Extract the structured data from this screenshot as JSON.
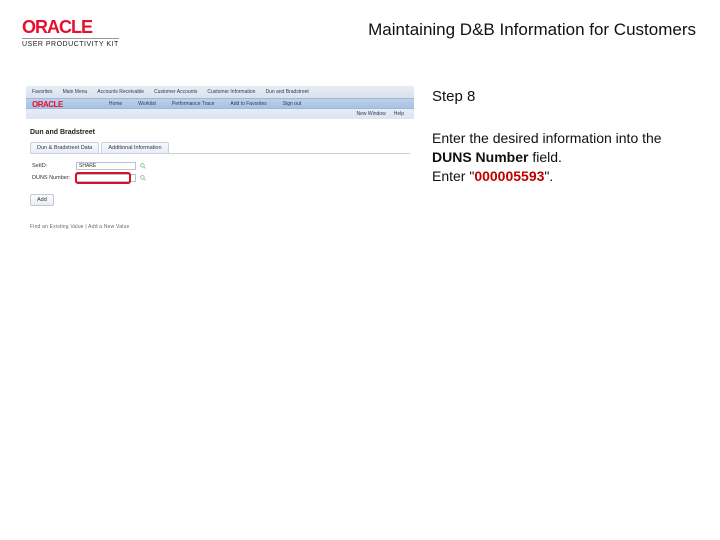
{
  "header": {
    "logo_text": "ORACLE",
    "logo_sub": "USER PRODUCTIVITY KIT",
    "title": "Maintaining D&B Information for Customers"
  },
  "mini": {
    "top": [
      "Favorites",
      "Main Menu",
      "Accounts Receivable",
      "Customer Accounts",
      "Customer Information",
      "Dun and Bradstreet"
    ],
    "logo": "ORACLE",
    "bar2": [
      "Home",
      "Worklist",
      "Performance Trace",
      "Add to Favorites",
      "Sign out"
    ],
    "bar3": [
      "New Window",
      "Help"
    ],
    "heading": "Dun and Bradstreet",
    "tabs": [
      "Dun & Bradstreet Data",
      "Additional Information"
    ],
    "row1_label": "SetID:",
    "row1_value": "SHARE",
    "row2_label": "DUNS Number:",
    "row2_value": "",
    "add_btn": "Add",
    "footer": "Find an Existing Value | Add a New Value"
  },
  "right": {
    "step": "Step 8",
    "line1": "Enter the desired information into the ",
    "field_label": "DUNS Number",
    "line1_after": " field.",
    "line2_before": "Enter \"",
    "value": "000005593",
    "line2_after": "\"."
  }
}
